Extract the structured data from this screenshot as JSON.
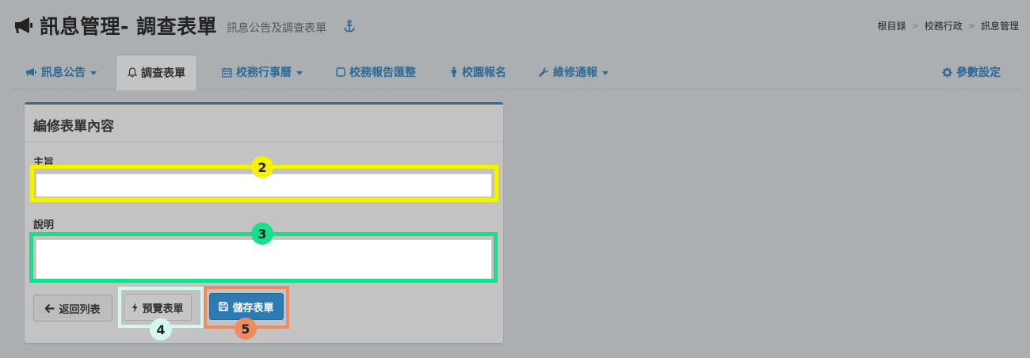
{
  "header": {
    "title": "訊息管理- 調查表單",
    "subtitle": "訊息公告及調查表單",
    "title_icon": "megaphone-icon",
    "anchor_icon": "anchor-icon"
  },
  "breadcrumb": {
    "items": [
      "根目錄",
      "校務行政",
      "訊息管理"
    ],
    "separator": ">"
  },
  "nav": {
    "tabs": [
      {
        "label": "訊息公告",
        "icon": "megaphone-icon",
        "dropdown": true
      },
      {
        "label": "調查表單",
        "icon": "bell-icon",
        "active": true
      },
      {
        "label": "校務行事曆",
        "icon": "calendar-icon",
        "dropdown": true
      },
      {
        "label": "校務報告匯整",
        "icon": "square-icon"
      },
      {
        "label": "校園報名",
        "icon": "signup-icon"
      },
      {
        "label": "維修通報",
        "icon": "wrench-icon",
        "dropdown": true
      },
      {
        "label": "參數設定",
        "icon": "gear-icon"
      }
    ]
  },
  "form": {
    "panel_title": "編修表單內容",
    "subject_label": "主旨",
    "subject_value": "",
    "description_label": "說明",
    "description_value": "",
    "buttons": {
      "back": "返回列表",
      "preview": "預覽表單",
      "save": "儲存表單"
    }
  },
  "markers": {
    "subject": "2",
    "description": "3",
    "preview": "4",
    "save": "5"
  },
  "colors": {
    "accent": "#2e6a96",
    "primary_button": "#2e7bb3",
    "marker_yellow": "#f5f200",
    "marker_green": "#16e08b",
    "marker_mint": "#d6f7ee",
    "marker_orange": "#f08a62"
  }
}
